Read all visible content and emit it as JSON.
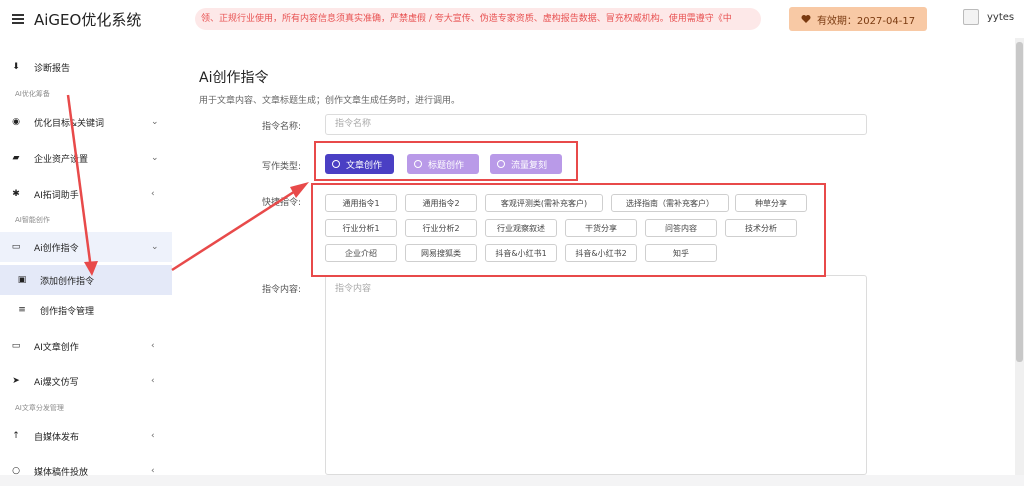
{
  "header": {
    "brand": "AiGEO优化系统",
    "notice": "领、正规行业使用，所有内容信息须真实准确，严禁虚假 / 夸大宣传、伪造专家资质、虚构报告数据、冒充权威机构。使用需遵守《中",
    "expiry": "有效期：2027-04-17",
    "username": "yytes"
  },
  "sidebar": {
    "items": [
      {
        "label": "诊断报告",
        "icon": "download-icon"
      },
      {
        "label": "优化目标&关键词",
        "icon": "target-icon",
        "chevron": "⌄"
      },
      {
        "label": "企业资产设置",
        "icon": "book-icon",
        "chevron": "⌄"
      },
      {
        "label": "AI拓词助手",
        "icon": "gear-icon",
        "chevron": "‹"
      },
      {
        "label": "Ai创作指令",
        "icon": "folder-icon",
        "chevron": "⌄"
      },
      {
        "label": "添加创作指令",
        "icon": "edit-doc-icon"
      },
      {
        "label": "创作指令管理",
        "icon": "list-icon"
      },
      {
        "label": "AI文章创作",
        "icon": "folder-icon",
        "chevron": "‹"
      },
      {
        "label": "Ai爆文仿写",
        "icon": "send-icon",
        "chevron": "‹"
      },
      {
        "label": "自媒体发布",
        "icon": "arrow-up-icon",
        "chevron": "‹"
      },
      {
        "label": "媒体稿件投放",
        "icon": "circle-icon",
        "chevron": "‹"
      }
    ],
    "sections": [
      "AI优化筹备",
      "AI智能创作",
      "AI文章分发管理"
    ]
  },
  "main": {
    "title": "Ai创作指令",
    "description": "用于文章内容、文章标题生成；创作文章生成任务时，进行调用。",
    "name_label": "指令名称:",
    "name_placeholder": "指令名称",
    "type_label": "写作类型:",
    "types": [
      "文章创作",
      "标题创作",
      "流量复刻"
    ],
    "selected_type": "文章创作",
    "quick_label": "快捷指令:",
    "quick_buttons": [
      "通用指令1",
      "通用指令2",
      "客观评测类(需补充客户)",
      "选择指南（需补充客户）",
      "种草分享",
      "行业分析1",
      "行业分析2",
      "行业观察叙述",
      "干货分享",
      "问答内容",
      "技术分析",
      "企业介绍",
      "网易搜狐类",
      "抖音&小红书1",
      "抖音&小红书2",
      "知乎"
    ],
    "content_label": "指令内容:",
    "content_placeholder": "指令内容"
  },
  "colors": {
    "accent": "#4a3fc4",
    "radio_off": "#b99ae8",
    "annotation": "#e84a4a",
    "notice_bg": "#fde8e8",
    "expiry_bg": "#f8c9a5"
  }
}
